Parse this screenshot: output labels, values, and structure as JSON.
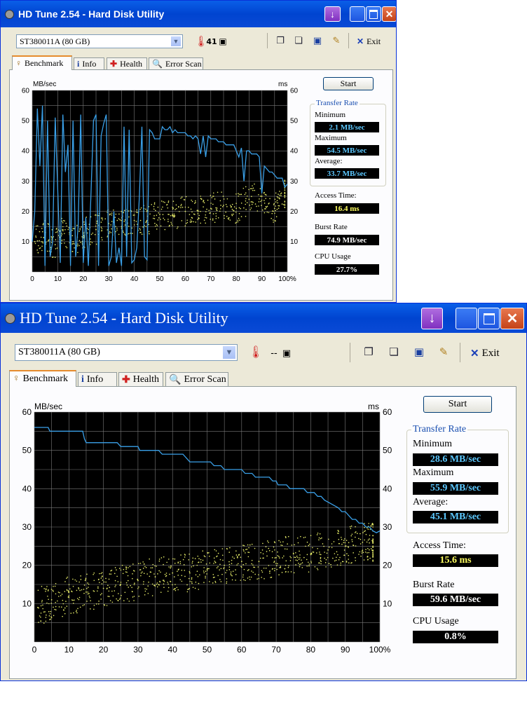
{
  "colors": {
    "title_bar": "#0a5fe8",
    "plot_bg": "#000000",
    "grid": "#7a7a7a",
    "line": "#3aa0e8",
    "dots": "#e8ee6a",
    "value_blue": "#5cc8ff",
    "value_yellow": "#ffff60",
    "value_white": "#ffffff"
  },
  "icons": {
    "app": "disk-icon",
    "temperature": "thermometer-icon",
    "copy": "copy-icon",
    "paste": "paste-icon",
    "save": "save-icon",
    "options": "options-icon",
    "exit": "exit-icon",
    "benchmark": "benchmark-icon",
    "info": "info-icon",
    "health": "health-icon",
    "error_scan": "error-scan-icon"
  },
  "windows": [
    {
      "title": "HD Tune 2.54 - Hard Disk Utility",
      "drive": "ST380011A (80 GB)",
      "temperature": "41",
      "exit_label": "Exit",
      "tabs": [
        "Benchmark",
        "Info",
        "Health",
        "Error Scan"
      ],
      "start_label": "Start",
      "stats": {
        "transfer_rate_title": "Transfer Rate",
        "minimum_label": "Minimum",
        "minimum": "2.1 MB/sec",
        "maximum_label": "Maximum",
        "maximum": "54.5 MB/sec",
        "average_label": "Average:",
        "average": "33.7 MB/sec",
        "access_time_label": "Access Time:",
        "access_time": "16.4 ms",
        "burst_rate_label": "Burst Rate",
        "burst_rate": "74.9 MB/sec",
        "cpu_usage_label": "CPU Usage",
        "cpu_usage": "27.7%"
      },
      "chart_data": {
        "type": "line",
        "ylabel_left": "MB/sec",
        "ylabel_right": "ms",
        "xlim": [
          0,
          100
        ],
        "ylim": [
          0,
          60
        ],
        "x_ticks": [
          "0",
          "10",
          "20",
          "30",
          "40",
          "50",
          "60",
          "70",
          "80",
          "90",
          "100%"
        ],
        "y_ticks": [
          "0",
          "10",
          "20",
          "30",
          "40",
          "50",
          "60"
        ],
        "grid": true,
        "series": [
          {
            "values": [
              [
                0,
                10
              ],
              [
                1,
                20
              ],
              [
                2,
                54
              ],
              [
                3,
                35
              ],
              [
                4,
                55
              ],
              [
                5,
                2
              ],
              [
                6,
                50
              ],
              [
                7,
                5
              ],
              [
                8,
                10
              ],
              [
                9,
                51
              ],
              [
                11,
                3
              ],
              [
                12,
                52
              ],
              [
                13,
                33
              ],
              [
                14,
                42
              ],
              [
                15,
                2
              ],
              [
                16,
                50
              ],
              [
                17,
                5
              ],
              [
                18,
                15
              ],
              [
                19,
                52
              ],
              [
                20,
                3
              ],
              [
                21,
                18
              ],
              [
                22,
                2
              ],
              [
                23,
                25
              ],
              [
                24,
                50
              ],
              [
                25,
                52
              ],
              [
                26,
                2
              ],
              [
                27,
                45
              ],
              [
                28,
                49
              ],
              [
                29,
                52
              ],
              [
                30,
                2
              ],
              [
                31,
                5
              ],
              [
                32,
                20
              ],
              [
                33,
                3
              ],
              [
                34,
                8
              ],
              [
                35,
                2
              ],
              [
                36,
                48
              ],
              [
                37,
                5
              ],
              [
                38,
                47
              ],
              [
                39,
                3
              ],
              [
                40,
                4
              ],
              [
                41,
                8
              ],
              [
                42,
                25
              ],
              [
                43,
                48
              ],
              [
                44,
                5
              ],
              [
                45,
                4
              ],
              [
                46,
                47
              ],
              [
                47,
                46
              ],
              [
                48,
                44
              ],
              [
                49,
                44
              ],
              [
                50,
                44
              ],
              [
                51,
                48
              ],
              [
                52,
                47
              ],
              [
                53,
                47
              ],
              [
                54,
                48
              ],
              [
                55,
                46
              ],
              [
                56,
                47
              ],
              [
                57,
                46
              ],
              [
                58,
                46
              ],
              [
                59,
                46
              ],
              [
                60,
                46
              ],
              [
                61,
                45
              ],
              [
                62,
                45
              ],
              [
                63,
                44
              ],
              [
                64,
                45
              ],
              [
                65,
                44
              ],
              [
                66,
                39
              ],
              [
                67,
                45
              ],
              [
                68,
                38
              ],
              [
                69,
                45
              ],
              [
                70,
                44
              ],
              [
                71,
                44
              ],
              [
                72,
                44
              ],
              [
                73,
                43
              ],
              [
                74,
                43
              ],
              [
                75,
                43
              ],
              [
                76,
                42
              ],
              [
                77,
                42
              ],
              [
                78,
                42
              ],
              [
                79,
                42
              ],
              [
                80,
                40
              ],
              [
                81,
                38
              ],
              [
                82,
                41
              ],
              [
                83,
                30
              ],
              [
                84,
                40
              ],
              [
                85,
                40
              ],
              [
                86,
                39
              ],
              [
                87,
                39
              ],
              [
                88,
                39
              ],
              [
                89,
                38
              ],
              [
                90,
                26
              ],
              [
                91,
                35
              ],
              [
                92,
                34
              ],
              [
                93,
                33
              ],
              [
                94,
                33
              ],
              [
                95,
                32
              ],
              [
                96,
                31
              ],
              [
                97,
                31
              ],
              [
                98,
                31
              ],
              [
                99,
                28
              ],
              [
                100,
                29
              ]
            ]
          },
          {
            "type": "scatter",
            "values": [
              [
                1,
                10
              ],
              [
                5,
                12
              ],
              [
                9,
                9
              ],
              [
                12,
                14
              ],
              [
                16,
                10
              ],
              [
                20,
                13
              ],
              [
                25,
                14
              ],
              [
                30,
                16
              ],
              [
                35,
                15
              ],
              [
                40,
                17
              ],
              [
                45,
                17
              ],
              [
                50,
                19
              ],
              [
                55,
                19
              ],
              [
                60,
                20
              ],
              [
                65,
                20
              ],
              [
                70,
                21
              ],
              [
                75,
                22
              ],
              [
                80,
                21
              ],
              [
                85,
                24
              ],
              [
                90,
                25
              ],
              [
                95,
                21
              ],
              [
                99,
                26
              ]
            ]
          }
        ]
      }
    },
    {
      "title": "HD Tune 2.54 - Hard Disk Utility",
      "drive": "ST380011A (80 GB)",
      "temperature": "--",
      "exit_label": "Exit",
      "tabs": [
        "Benchmark",
        "Info",
        "Health",
        "Error Scan"
      ],
      "start_label": "Start",
      "stats": {
        "transfer_rate_title": "Transfer Rate",
        "minimum_label": "Minimum",
        "minimum": "28.6 MB/sec",
        "maximum_label": "Maximum",
        "maximum": "55.9 MB/sec",
        "average_label": "Average:",
        "average": "45.1 MB/sec",
        "access_time_label": "Access Time:",
        "access_time": "15.6 ms",
        "burst_rate_label": "Burst Rate",
        "burst_rate": "59.6 MB/sec",
        "cpu_usage_label": "CPU Usage",
        "cpu_usage": "0.8%"
      },
      "chart_data": {
        "type": "line",
        "ylabel_left": "MB/sec",
        "ylabel_right": "ms",
        "xlim": [
          0,
          100
        ],
        "ylim": [
          0,
          60
        ],
        "x_ticks": [
          "0",
          "10",
          "20",
          "30",
          "40",
          "50",
          "60",
          "70",
          "80",
          "90",
          "100%"
        ],
        "y_ticks": [
          "0",
          "10",
          "20",
          "30",
          "40",
          "50",
          "60"
        ],
        "grid": true,
        "series": [
          {
            "values": [
              [
                0,
                56
              ],
              [
                4,
                56
              ],
              [
                4.5,
                55
              ],
              [
                14,
                55
              ],
              [
                14.5,
                53
              ],
              [
                15,
                52
              ],
              [
                24,
                52
              ],
              [
                25,
                51
              ],
              [
                30,
                51
              ],
              [
                30.5,
                50
              ],
              [
                36,
                50
              ],
              [
                36.5,
                49.5
              ],
              [
                37,
                49
              ],
              [
                43,
                49
              ],
              [
                44,
                48
              ],
              [
                45,
                47
              ],
              [
                51,
                47
              ],
              [
                52,
                46
              ],
              [
                54,
                46
              ],
              [
                55,
                45
              ],
              [
                60,
                45
              ],
              [
                61,
                44
              ],
              [
                63,
                44
              ],
              [
                64,
                43
              ],
              [
                68,
                43
              ],
              [
                69,
                42
              ],
              [
                70,
                42
              ],
              [
                70.5,
                41
              ],
              [
                73,
                41
              ],
              [
                74,
                40
              ],
              [
                78,
                40
              ],
              [
                79,
                39
              ],
              [
                81,
                39
              ],
              [
                82,
                38
              ],
              [
                83,
                38
              ],
              [
                84,
                37
              ],
              [
                86,
                36
              ],
              [
                88,
                35
              ],
              [
                89,
                34
              ],
              [
                90,
                34
              ],
              [
                91,
                33
              ],
              [
                92,
                32
              ],
              [
                93,
                32
              ],
              [
                94,
                31
              ],
              [
                95,
                31
              ],
              [
                96,
                30
              ],
              [
                97,
                30
              ],
              [
                98,
                29
              ],
              [
                99,
                28.5
              ],
              [
                100,
                29
              ]
            ]
          },
          {
            "type": "scatter",
            "values": [
              [
                1,
                9
              ],
              [
                5,
                11
              ],
              [
                10,
                12
              ],
              [
                15,
                13
              ],
              [
                20,
                14
              ],
              [
                25,
                15
              ],
              [
                30,
                16
              ],
              [
                35,
                17
              ],
              [
                40,
                18
              ],
              [
                45,
                18
              ],
              [
                50,
                19
              ],
              [
                55,
                20
              ],
              [
                60,
                21
              ],
              [
                65,
                21
              ],
              [
                70,
                22
              ],
              [
                75,
                23
              ],
              [
                80,
                23
              ],
              [
                85,
                24
              ],
              [
                90,
                25
              ],
              [
                95,
                26
              ],
              [
                98,
                26
              ]
            ]
          }
        ]
      }
    }
  ]
}
